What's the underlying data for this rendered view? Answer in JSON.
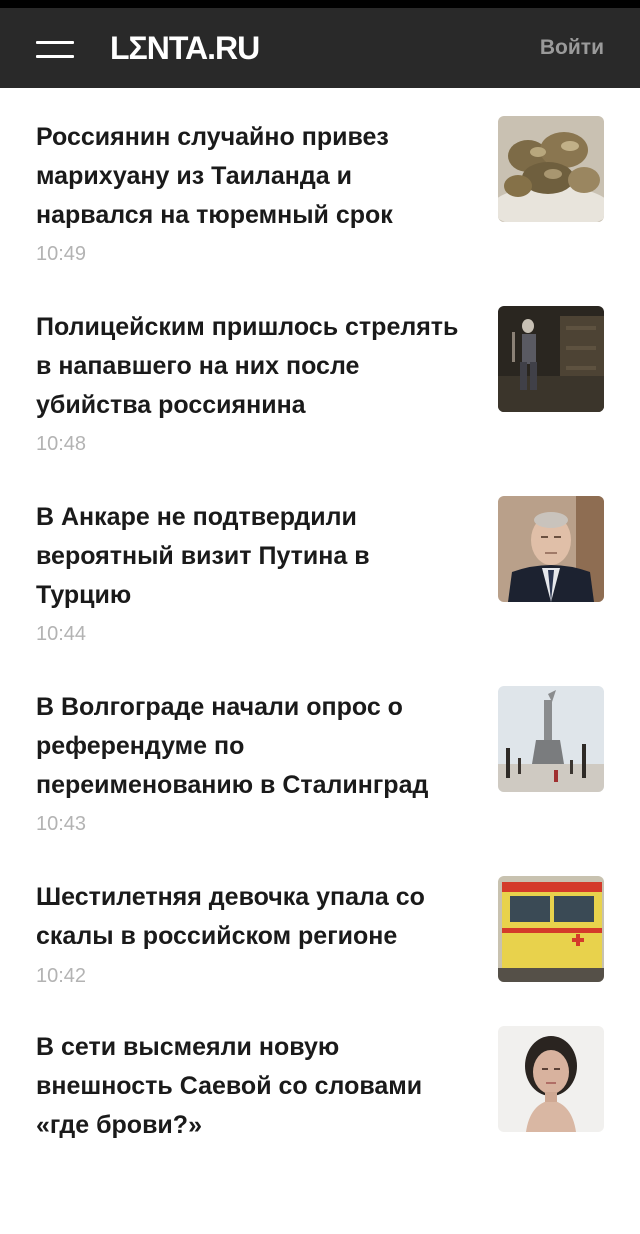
{
  "header": {
    "logo": "LΣNTA.RU",
    "login_label": "Войти"
  },
  "news": [
    {
      "title": "Россиянин случайно привез марихуану из Таиланда и нарвался на тюремный срок",
      "time": "10:49"
    },
    {
      "title": "Полицейским пришлось стрелять в напавшего на них после убийства россиянина",
      "time": "10:48"
    },
    {
      "title": "В Анкаре не подтвердили вероятный визит Путина в Турцию",
      "time": "10:44"
    },
    {
      "title": "В Волгограде начали опрос о референдуме по переименованию в Сталинград",
      "time": "10:43"
    },
    {
      "title": "Шестилетняя девочка упала со скалы в российском регионе",
      "time": "10:42"
    },
    {
      "title": "В сети высмеяли новую внешность Саевой со словами «где брови?»",
      "time": ""
    }
  ]
}
